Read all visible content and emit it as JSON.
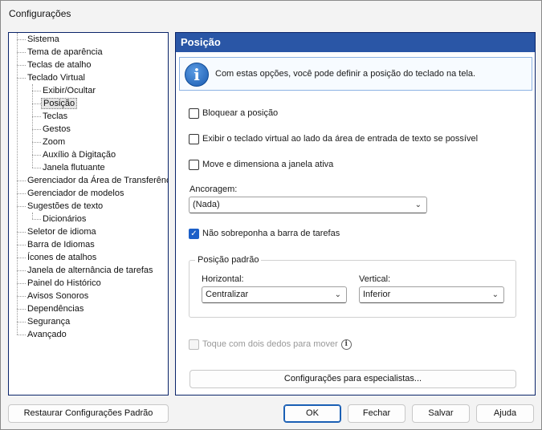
{
  "window": {
    "title": "Configurações"
  },
  "tree": {
    "items": [
      {
        "label": "Sistema",
        "level": 0
      },
      {
        "label": "Tema de aparência",
        "level": 0
      },
      {
        "label": "Teclas de atalho",
        "level": 0
      },
      {
        "label": "Teclado Virtual",
        "level": 0
      },
      {
        "label": "Exibir/Ocultar",
        "level": 1
      },
      {
        "label": "Posição",
        "level": 1,
        "selected": true
      },
      {
        "label": "Teclas",
        "level": 1
      },
      {
        "label": "Gestos",
        "level": 1
      },
      {
        "label": "Zoom",
        "level": 1
      },
      {
        "label": "Auxílio à Digitação",
        "level": 1
      },
      {
        "label": "Janela flutuante",
        "level": 1
      },
      {
        "label": "Gerenciador da Área de Transferência",
        "level": 0
      },
      {
        "label": "Gerenciador de modelos",
        "level": 0
      },
      {
        "label": "Sugestões de texto",
        "level": 0
      },
      {
        "label": "Dicionários",
        "level": 1
      },
      {
        "label": "Seletor de idioma",
        "level": 0
      },
      {
        "label": "Barra de Idiomas",
        "level": 0
      },
      {
        "label": "Ícones de atalhos",
        "level": 0
      },
      {
        "label": "Janela de alternância de tarefas",
        "level": 0
      },
      {
        "label": "Painel do Histórico",
        "level": 0
      },
      {
        "label": "Avisos Sonoros",
        "level": 0
      },
      {
        "label": "Dependências",
        "level": 0
      },
      {
        "label": "Segurança",
        "level": 0
      },
      {
        "label": "Avançado",
        "level": 0
      }
    ]
  },
  "panel": {
    "title": "Posição",
    "info": "Com estas opções, você pode definir a posição do teclado na tela.",
    "lock_position": {
      "label": "Bloquear a posição",
      "checked": false
    },
    "show_beside_input": {
      "label": "Exibir o teclado virtual ao lado da área de entrada de texto se possível",
      "checked": false
    },
    "move_resize_active": {
      "label": "Move e dimensiona a janela ativa",
      "checked": false
    },
    "anchoring": {
      "label": "Ancoragem:",
      "value": "(Nada)"
    },
    "no_overlap_taskbar": {
      "label": "Não sobreponha a barra de tarefas",
      "checked": true
    },
    "default_position": {
      "legend": "Posição padrão",
      "horizontal_label": "Horizontal:",
      "horizontal_value": "Centralizar",
      "vertical_label": "Vertical:",
      "vertical_value": "Inferior"
    },
    "two_finger_move": {
      "label": "Toque com dois dedos para mover",
      "checked": false,
      "disabled": true
    },
    "expert_button": "Configurações para especialistas..."
  },
  "footer": {
    "restore_label": "Restaurar Configurações Padrão",
    "ok_label": "OK",
    "close_label": "Fechar",
    "save_label": "Salvar",
    "help_label": "Ajuda"
  },
  "colors": {
    "header": "#2a56a6",
    "accent": "#1c5fc8"
  },
  "icons": {
    "info": "info-icon",
    "help": "help-icon",
    "chevron": "chevron-down-icon",
    "check": "checkmark-icon"
  }
}
